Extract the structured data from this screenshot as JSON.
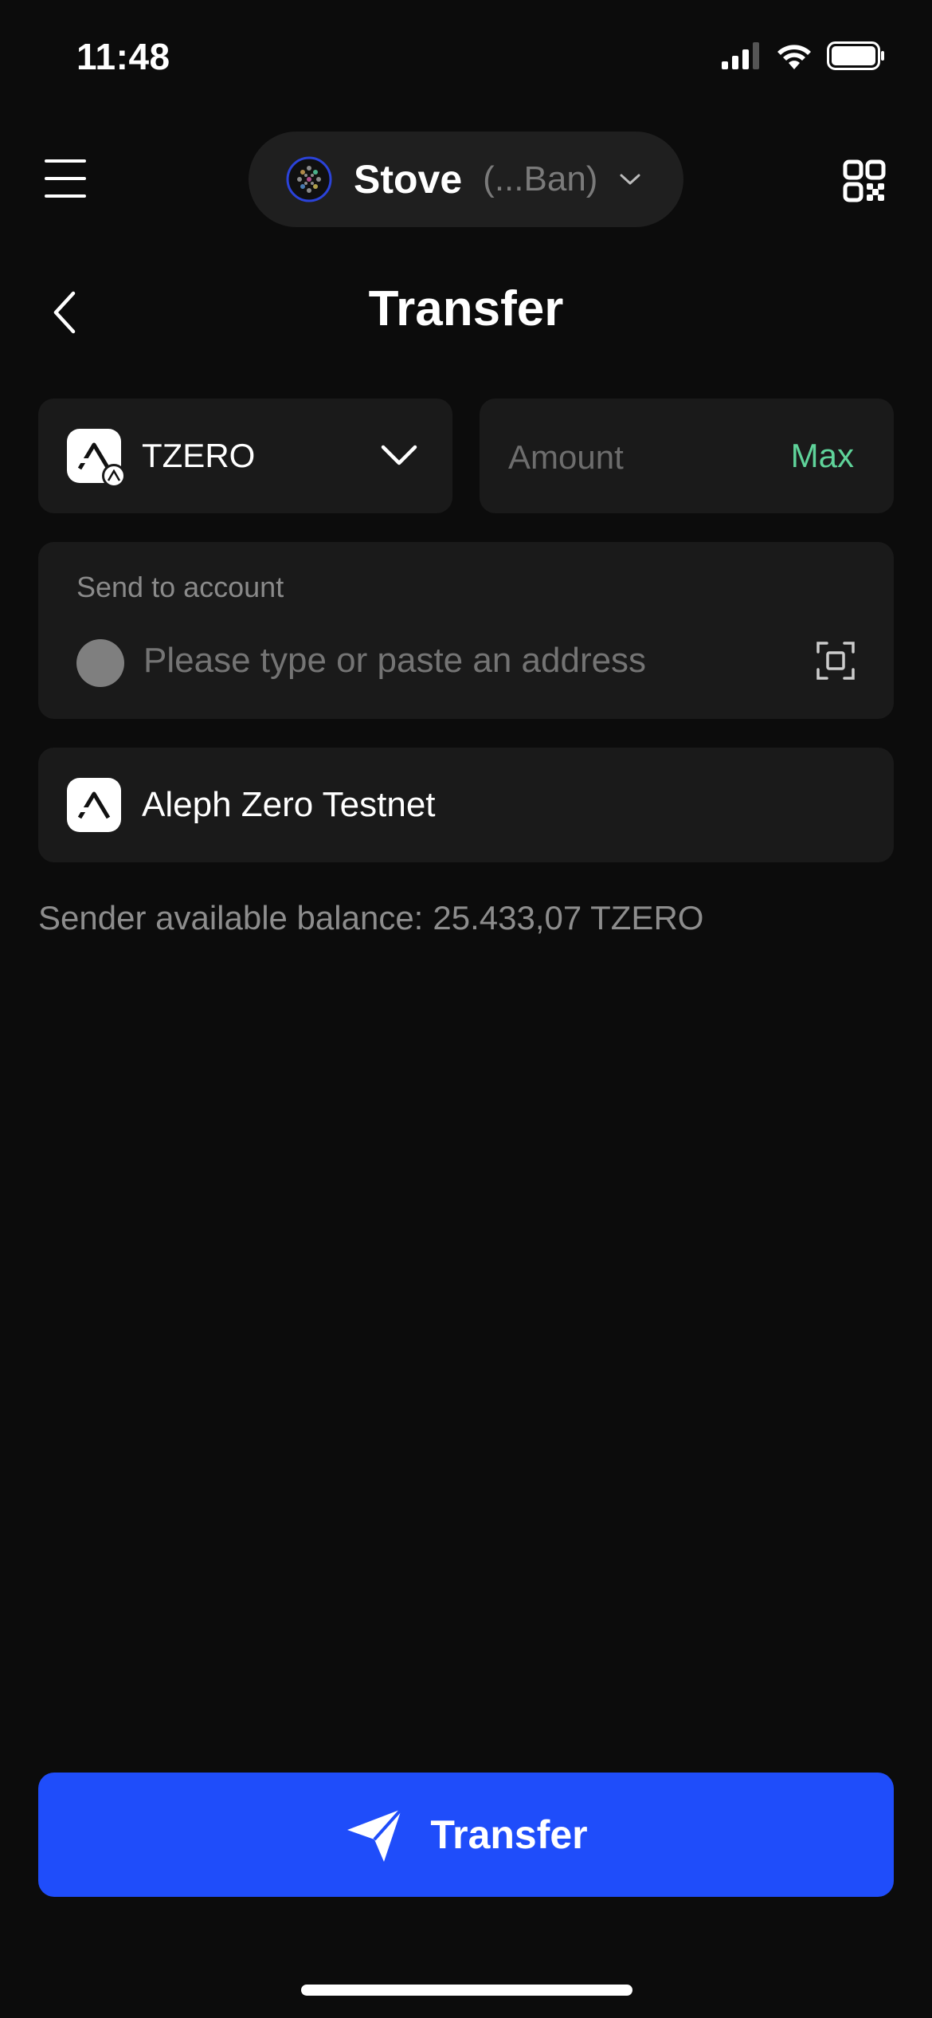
{
  "status_bar": {
    "time": "11:48"
  },
  "header": {
    "account_name": "Stove",
    "account_address": "(...Ban)"
  },
  "page": {
    "title": "Transfer"
  },
  "token": {
    "symbol": "TZERO"
  },
  "amount": {
    "placeholder": "Amount",
    "max_label": "Max"
  },
  "send_to": {
    "label": "Send to account",
    "placeholder": "Please type or paste an address"
  },
  "network": {
    "name": "Aleph Zero Testnet"
  },
  "balance": {
    "label": "Sender available balance:",
    "value": "25.433,07 TZERO"
  },
  "transfer_button": {
    "label": "Transfer"
  },
  "colors": {
    "background": "#0c0c0c",
    "card": "#1a1a1a",
    "accent_blue": "#1f4dfa",
    "max_green": "#5fd39a"
  },
  "icons": [
    "signal-icon",
    "wifi-icon",
    "battery-icon",
    "menu-icon",
    "account-avatar-icon",
    "chevron-down-icon",
    "qr-code-icon",
    "back-icon",
    "aleph-zero-logo-icon",
    "scan-icon",
    "send-icon"
  ]
}
